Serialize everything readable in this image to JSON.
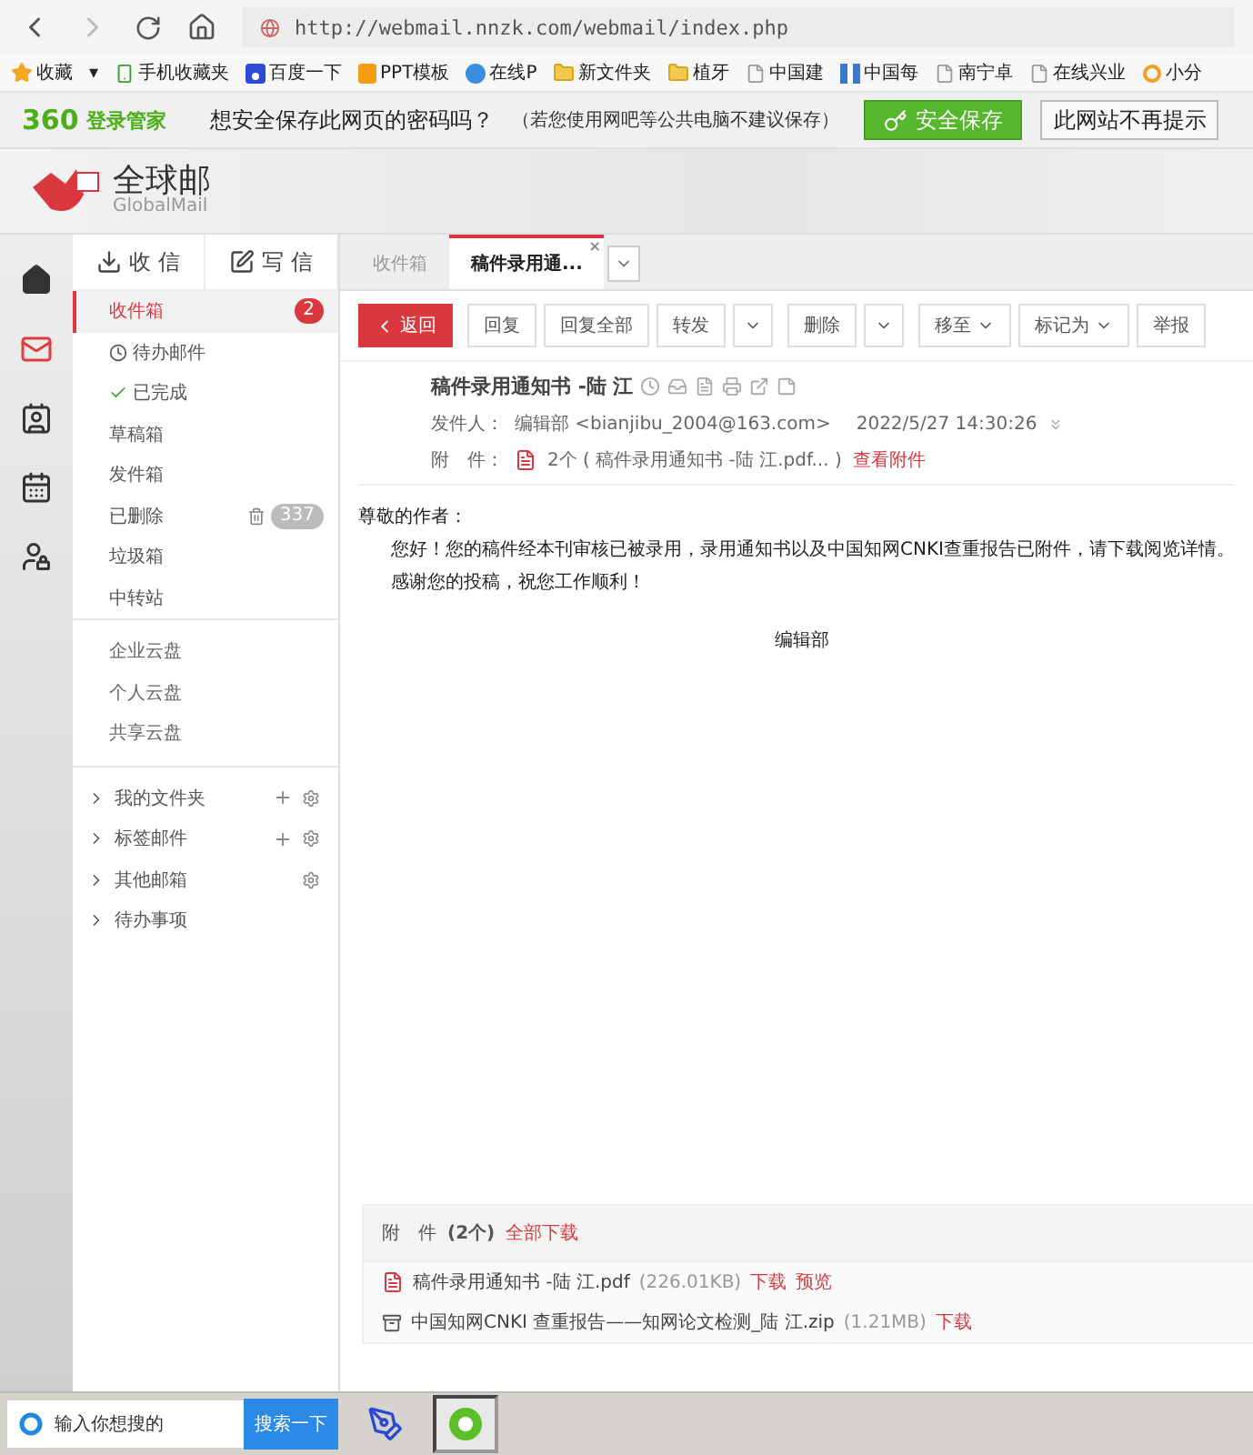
{
  "browser": {
    "url": "http://webmail.nnzk.com/webmail/index.php",
    "bookmarks": [
      {
        "label": "收藏",
        "kind": "star"
      },
      {
        "label": "▾",
        "kind": "text"
      },
      {
        "label": "手机收藏夹",
        "kind": "phone"
      },
      {
        "label": "百度一下",
        "kind": "paw"
      },
      {
        "label": "PPT模板",
        "kind": "ppt"
      },
      {
        "label": "在线P",
        "kind": "circle"
      },
      {
        "label": "新文件夹",
        "kind": "folder"
      },
      {
        "label": "植牙",
        "kind": "folder"
      },
      {
        "label": "中国建",
        "kind": "page"
      },
      {
        "label": "中国每",
        "kind": "grid"
      },
      {
        "label": "南宁卓",
        "kind": "page"
      },
      {
        "label": "在线兴业",
        "kind": "page"
      },
      {
        "label": "小分",
        "kind": "ring"
      }
    ]
  },
  "password_bar": {
    "brand": "360",
    "brand_sub": "登录管家",
    "question": "想安全保存此网页的密码吗？",
    "hint": "（若您使用网吧等公共电脑不建议保存）",
    "save": "安全保存",
    "never": "此网站不再提示"
  },
  "header": {
    "logo": "全球邮",
    "logo_sub": "GlobalMail"
  },
  "sidebar": {
    "receive": "收 信",
    "compose": "写 信",
    "folders": [
      {
        "label": "收件箱",
        "selected": true,
        "count": "2",
        "kind": "badge"
      },
      {
        "label": "待办邮件",
        "selected": false,
        "kind": "clock"
      },
      {
        "label": "已完成",
        "selected": false,
        "kind": "check"
      },
      {
        "label": "草稿箱",
        "selected": false,
        "kind": "plain"
      },
      {
        "label": "发件箱",
        "selected": false,
        "kind": "plain"
      },
      {
        "label": "已删除",
        "selected": false,
        "count": "337",
        "kind": "trash"
      },
      {
        "label": "垃圾箱",
        "selected": false,
        "kind": "plain"
      },
      {
        "label": "中转站",
        "selected": false,
        "kind": "plain"
      }
    ],
    "clouds": [
      "企业云盘",
      "个人云盘",
      "共享云盘"
    ],
    "groups": [
      {
        "label": "我的文件夹",
        "add": true,
        "settings": true
      },
      {
        "label": "标签邮件",
        "add": true,
        "settings": true
      },
      {
        "label": "其他邮箱",
        "add": false,
        "settings": true
      },
      {
        "label": "待办事项",
        "add": false,
        "settings": false
      }
    ]
  },
  "tabs": [
    {
      "label": "收件箱",
      "selected": false
    },
    {
      "label": "稿件录用通...",
      "selected": true,
      "close": "×"
    }
  ],
  "toolbar": [
    {
      "label": "返回",
      "kind": "back"
    },
    {
      "label": "回复",
      "kind": "plain"
    },
    {
      "label": "回复全部",
      "kind": "plain"
    },
    {
      "label": "转发",
      "kind": "split"
    },
    {
      "label": "删除",
      "kind": "split"
    },
    {
      "label": "移至",
      "kind": "menu"
    },
    {
      "label": "标记为",
      "kind": "menu"
    },
    {
      "label": "举报",
      "kind": "plain"
    }
  ],
  "message": {
    "subject": "稿件录用通知书 -陆 江",
    "sender_label": "发件人：",
    "sender": "编辑部 <bianjibu_2004@163.com>",
    "date": "2022/5/27 14:30:26",
    "attach_label": "附　件：",
    "attach_summary": "2个 ( 稿件录用通知书 -陆 江.pdf... )",
    "attach_link": "查看附件",
    "greeting": "尊敬的作者：",
    "paragraphs": [
      "您好！您的稿件经本刊审核已被录用，录用通知书以及中国知网CNKI查重报告已附件，请下载阅览详情。",
      "感谢您的投稿，祝您工作顺利！"
    ],
    "signature": "编辑部"
  },
  "attachments": {
    "label": "附　件",
    "count": "(2个)",
    "download_all": "全部下载",
    "files": [
      {
        "name": "稿件录用通知书 -陆 江.pdf",
        "size": "(226.01KB)",
        "kind": "pdf",
        "actions": [
          "下载",
          "预览"
        ]
      },
      {
        "name": "中国知网CNKI 查重报告——知网论文检测_陆 江.zip",
        "size": "(1.21MB)",
        "kind": "zip",
        "actions": [
          "下载"
        ]
      }
    ]
  },
  "taskbar": {
    "search_placeholder": "输入你想搜的",
    "search_button": "搜索一下"
  }
}
